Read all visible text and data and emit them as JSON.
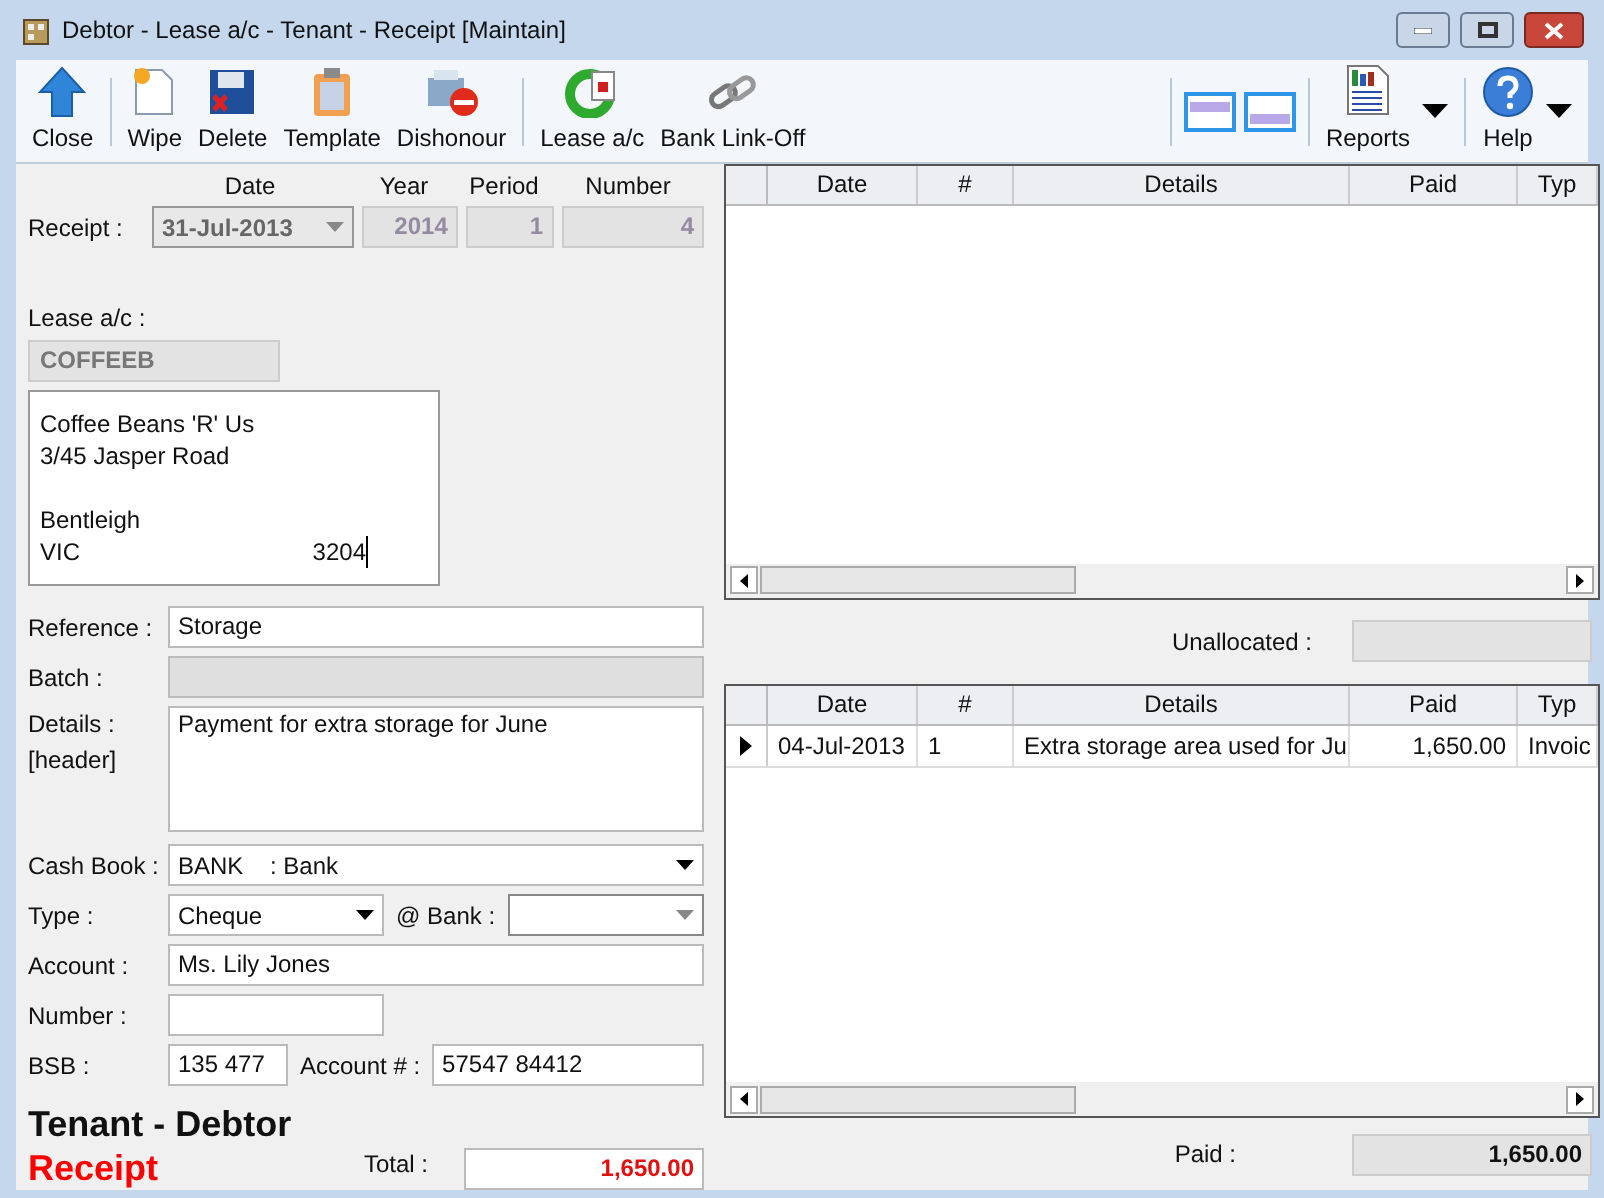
{
  "window": {
    "title": "Debtor - Lease a/c - Tenant - Receipt [Maintain]"
  },
  "toolbar": {
    "buttons": [
      {
        "kind": "close",
        "label": "Close"
      },
      {
        "kind": "wipe",
        "label": "Wipe"
      },
      {
        "kind": "delete",
        "label": "Delete"
      },
      {
        "kind": "template",
        "label": "Template"
      },
      {
        "kind": "dishonour",
        "label": "Dishonour"
      },
      {
        "kind": "lease",
        "label": "Lease a/c"
      },
      {
        "kind": "link",
        "label": "Bank Link-Off"
      }
    ],
    "menus": [
      {
        "kind": "reports",
        "label": "Reports"
      },
      {
        "kind": "help",
        "label": "Help"
      }
    ]
  },
  "receipt": {
    "label": "Receipt :",
    "date_heading": "Date",
    "year_heading": "Year",
    "period_heading": "Period",
    "number_heading": "Number",
    "date": "31-Jul-2013",
    "year": "2014",
    "period": "1",
    "number": "4"
  },
  "lease": {
    "label": "Lease a/c :",
    "code": "COFFEEB",
    "address": {
      "name": "Coffee Beans 'R' Us",
      "street": "3/45 Jasper Road",
      "suburb": "Bentleigh",
      "state": "VIC",
      "postcode": "3204"
    }
  },
  "form": {
    "reference": {
      "label": "Reference :",
      "value": "Storage"
    },
    "batch": {
      "label": "Batch :",
      "disabled": true
    },
    "details": {
      "label": "Details :",
      "sublabel": "[header]",
      "value": "Payment for extra storage for June"
    },
    "cash_book": {
      "label": "Cash Book :",
      "code": "BANK",
      "name": ": Bank"
    },
    "type": {
      "label": "Type :",
      "value": "Cheque"
    },
    "bank": {
      "label": "@ Bank :"
    },
    "account": {
      "label": "Account :",
      "value": "Ms. Lily Jones"
    },
    "number": {
      "label": "Number :"
    },
    "bsb": {
      "label": "BSB :",
      "value": "135 477"
    },
    "account_no": {
      "label": "Account # :",
      "value": "57547 84412"
    }
  },
  "footer": {
    "heading": "Tenant - Debtor",
    "subheading": "Receipt",
    "total_label": "Total :",
    "total": "1,650.00"
  },
  "top_grid": {
    "columns": [
      "Date",
      "#",
      "Details",
      "Paid",
      "Typ"
    ]
  },
  "unallocated": {
    "label": "Unallocated :"
  },
  "bottom_grid": {
    "columns": [
      "Date",
      "#",
      "Details",
      "Paid",
      "Typ"
    ],
    "rows": [
      {
        "current": true,
        "cells": [
          "04-Jul-2013",
          "1",
          "Extra storage area used for Ju",
          "1,650.00",
          "Invoic"
        ]
      }
    ]
  },
  "paid": {
    "label": "Paid :",
    "value": "1,650.00"
  }
}
